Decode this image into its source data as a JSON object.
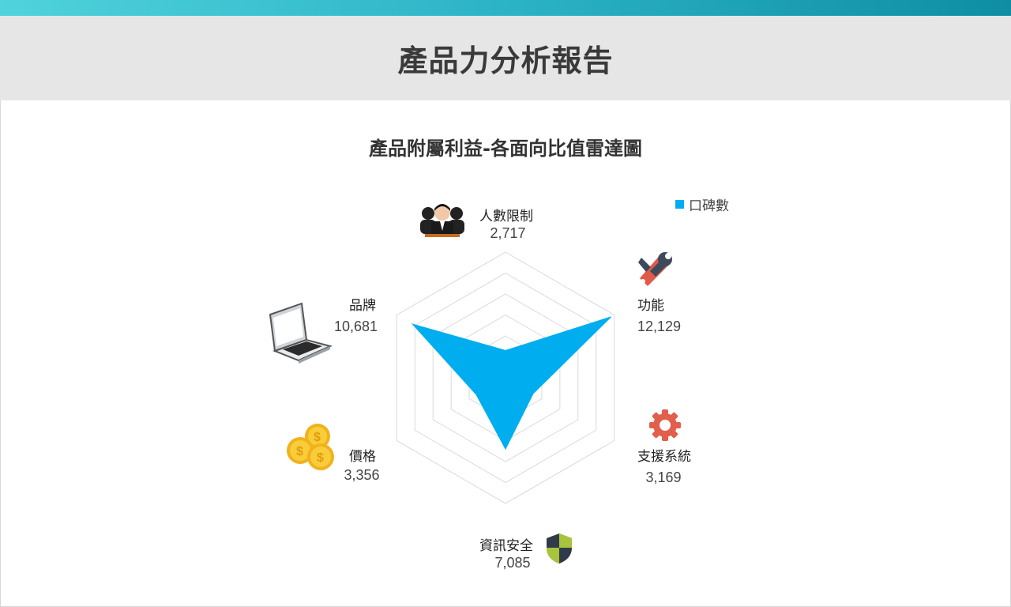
{
  "header": {
    "title": "產品力分析報告"
  },
  "chart_data": {
    "type": "radar",
    "title": "產品附屬利益-各面向比值雷達圖",
    "legend": {
      "position": "top-right",
      "entries": [
        "口碑數"
      ]
    },
    "axes": [
      "人數限制",
      "功能",
      "支援系統",
      "資訊安全",
      "價格",
      "品牌"
    ],
    "value_labels": [
      "2,717",
      "12,129",
      "3,169",
      "7,085",
      "3,356",
      "10,681"
    ],
    "series": [
      {
        "name": "口碑數",
        "values": [
          2717,
          12129,
          3169,
          7085,
          3356,
          10681
        ],
        "color": "#00aeef"
      }
    ],
    "range": [
      0,
      12500
    ],
    "grid": true,
    "axis_icons": [
      "people-icon",
      "tools-icon",
      "gear-icon",
      "shield-icon",
      "coins-icon",
      "laptop-icon"
    ]
  }
}
